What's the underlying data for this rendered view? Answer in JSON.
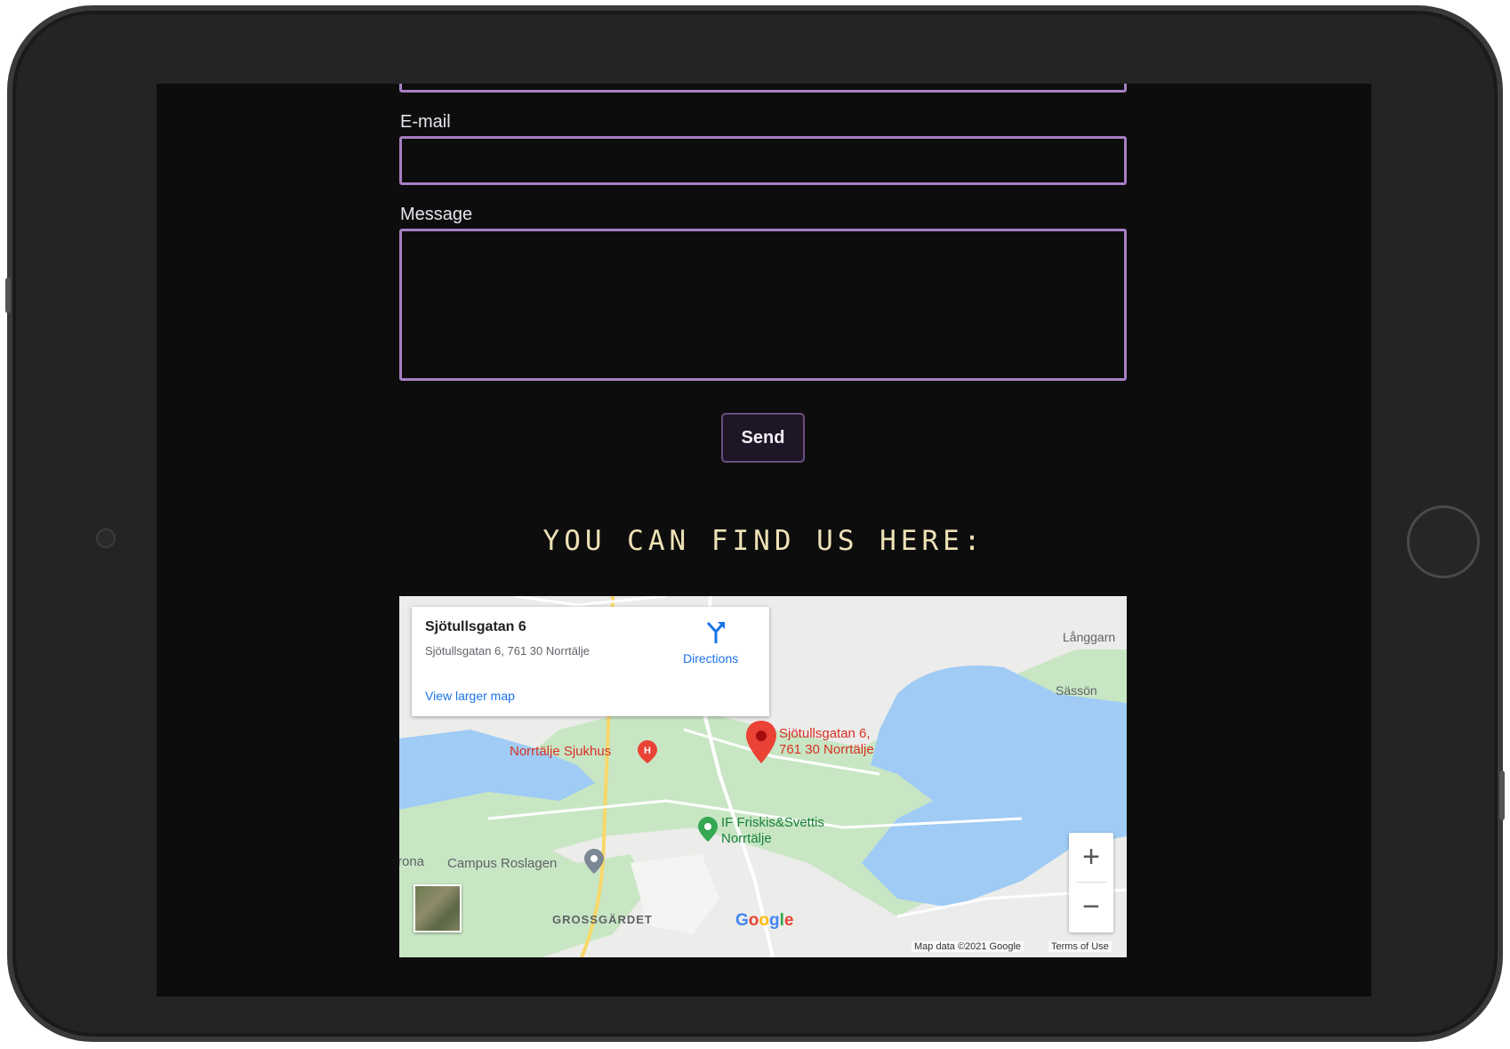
{
  "form": {
    "email_label": "E-mail",
    "email_value": "",
    "message_label": "Message",
    "message_value": "",
    "send_label": "Send"
  },
  "section": {
    "heading": "YOU CAN FIND US HERE:"
  },
  "map": {
    "place_name": "Sjötullsgatan 6",
    "place_address": "Sjötullsgatan 6, 761 30 Norrtälje",
    "directions_label": "Directions",
    "larger_map_label": "View larger map",
    "pin_label_line1": "Sjötullsgatan 6,",
    "pin_label_line2": "761 30 Norrtälje",
    "labels": {
      "hospital": "Norrtälje Sjukhus",
      "gym_line1": "IF Friskis&Svettis",
      "gym_line2": "Norrtälje",
      "campus": "Campus Roslagen",
      "campus_prefix": "rona",
      "district": "GROSSGÄRDET",
      "langgarn": "Långgarn",
      "sasson": "Sässön"
    },
    "zoom_in": "+",
    "zoom_out": "−",
    "logo": "Google",
    "map_data": "Map data ©2021 Google",
    "terms": "Terms of Use"
  },
  "colors": {
    "accent": "#a77fc4",
    "heading": "#efe2b6",
    "background": "#0e0d0e"
  }
}
